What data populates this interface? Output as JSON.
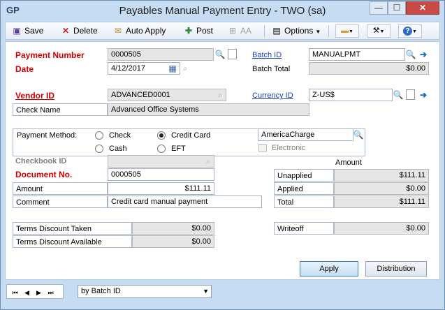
{
  "window": {
    "title": "Payables Manual Payment Entry  -  TWO (sa)",
    "app_icon": "GP",
    "controls": [
      "—",
      "☐",
      "✕"
    ]
  },
  "toolbar": {
    "save_label": "Save",
    "delete_label": "Delete",
    "auto_apply_label": "Auto Apply",
    "post_label": "Post",
    "aa_label": "AA",
    "options_label": "Options"
  },
  "form": {
    "payment_number_label": "Payment Number",
    "payment_number": "0000505",
    "date_label": "Date",
    "date": "4/12/2017",
    "batch_id_label": "Batch ID",
    "batch_id": "MANUALPMT",
    "batch_total_label": "Batch Total",
    "batch_total": "$0.00",
    "vendor_id_label": "Vendor ID",
    "vendor_id": "ADVANCED0001",
    "check_name_label": "Check Name",
    "check_name": "Advanced Office Systems",
    "currency_id_label": "Currency ID",
    "currency_id": "Z-US$",
    "payment_method_label": "Payment Method:",
    "methods": {
      "check": "Check",
      "credit_card": "Credit Card",
      "cash": "Cash",
      "eft": "EFT"
    },
    "selected_method": "Credit Card",
    "credit_card_name": "AmericaCharge",
    "electronic_label": "Electronic",
    "checkbook_id_label": "Checkbook ID",
    "checkbook_id": "",
    "document_no_label": "Document No.",
    "document_no": "0000505",
    "amount_label": "Amount",
    "amount": "$111.11",
    "comment_label": "Comment",
    "comment": "Credit card manual payment",
    "amount_header": "Amount",
    "unapplied_label": "Unapplied",
    "unapplied": "$111.11",
    "applied_label": "Applied",
    "applied": "$0.00",
    "total_label": "Total",
    "total": "$111.11",
    "terms_discount_taken_label": "Terms Discount Taken",
    "terms_discount_taken": "$0.00",
    "terms_discount_available_label": "Terms Discount Available",
    "terms_discount_available": "$0.00",
    "writeoff_label": "Writeoff",
    "writeoff": "$0.00",
    "apply_button": "Apply",
    "distribution_button": "Distribution"
  },
  "footer": {
    "sort_by": "by Batch ID"
  }
}
